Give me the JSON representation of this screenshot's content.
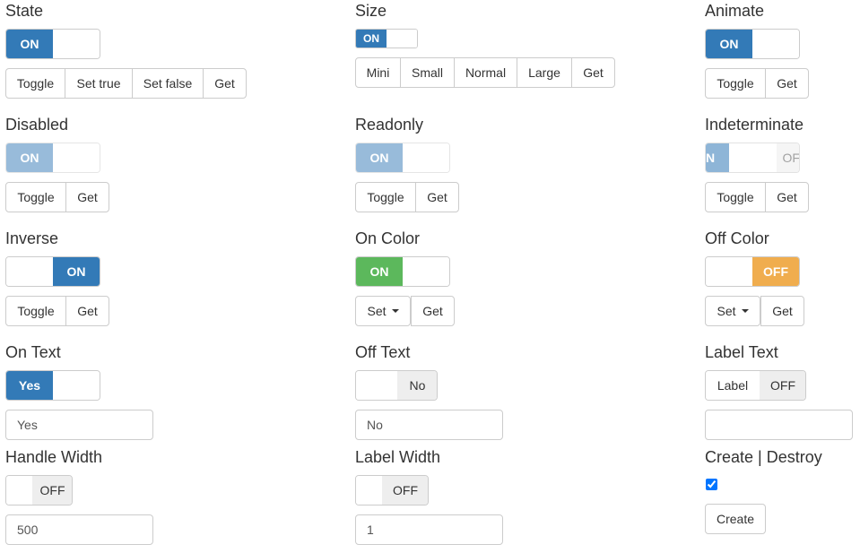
{
  "colors": {
    "primary": "#337ab7",
    "success": "#5cb85c",
    "warning": "#f0ad4e"
  },
  "state": {
    "title": "State",
    "on": "ON",
    "buttons": [
      "Toggle",
      "Set true",
      "Set false",
      "Get"
    ]
  },
  "size": {
    "title": "Size",
    "on": "ON",
    "buttons": [
      "Mini",
      "Small",
      "Normal",
      "Large",
      "Get"
    ]
  },
  "animate": {
    "title": "Animate",
    "on": "ON",
    "buttons": [
      "Toggle",
      "Get"
    ]
  },
  "disabled": {
    "title": "Disabled",
    "on": "ON",
    "buttons": [
      "Toggle",
      "Get"
    ]
  },
  "readonly": {
    "title": "Readonly",
    "on": "ON",
    "buttons": [
      "Toggle",
      "Get"
    ]
  },
  "indeterminate": {
    "title": "Indeterminate",
    "on": "N",
    "off": "OF",
    "buttons": [
      "Toggle",
      "Get"
    ]
  },
  "inverse": {
    "title": "Inverse",
    "on": "ON",
    "buttons": [
      "Toggle",
      "Get"
    ]
  },
  "on_color": {
    "title": "On Color",
    "on": "ON",
    "buttons": [
      "Set",
      "Get"
    ]
  },
  "off_color": {
    "title": "Off Color",
    "off": "OFF",
    "buttons": [
      "Set",
      "Get"
    ]
  },
  "on_text": {
    "title": "On Text",
    "on": "Yes",
    "input": "Yes"
  },
  "off_text": {
    "title": "Off Text",
    "off": "No",
    "input": "No"
  },
  "label_text": {
    "title": "Label Text",
    "label": "Label",
    "off": "OFF",
    "input": ""
  },
  "handle_width": {
    "title": "Handle Width",
    "off": "OFF",
    "input": "500"
  },
  "label_width": {
    "title": "Label Width",
    "off": "OFF",
    "input": "1"
  },
  "create_destroy": {
    "title": "Create | Destroy",
    "checked": true,
    "button": "Create"
  }
}
